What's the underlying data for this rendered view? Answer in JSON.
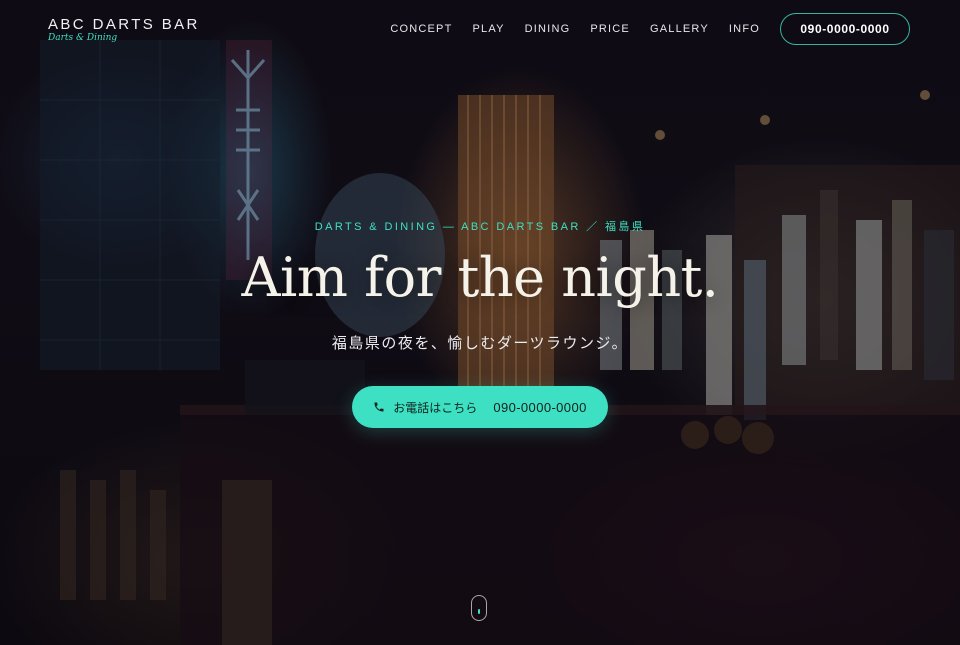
{
  "brand": {
    "name": "ABC DARTS BAR",
    "tagline": "Darts & Dining"
  },
  "nav": {
    "items": [
      "CONCEPT",
      "PLAY",
      "DINING",
      "PRICE",
      "GALLERY",
      "INFO"
    ],
    "phone": "090-0000-0000"
  },
  "hero": {
    "eyebrow": "DARTS & DINING — ABC DARTS BAR ／ 福島県",
    "headline": "Aim for the night.",
    "subline": "福島県の夜を、愉しむダーツラウンジ。",
    "cta_label": "お電話はこちら",
    "cta_phone": "090-0000-0000"
  },
  "icons": {
    "cta": "phone-icon",
    "scroll": "mouse-scroll-icon"
  },
  "colors": {
    "accent": "#3ee0c3",
    "text": "#f5f2ea",
    "background": "#141019"
  }
}
